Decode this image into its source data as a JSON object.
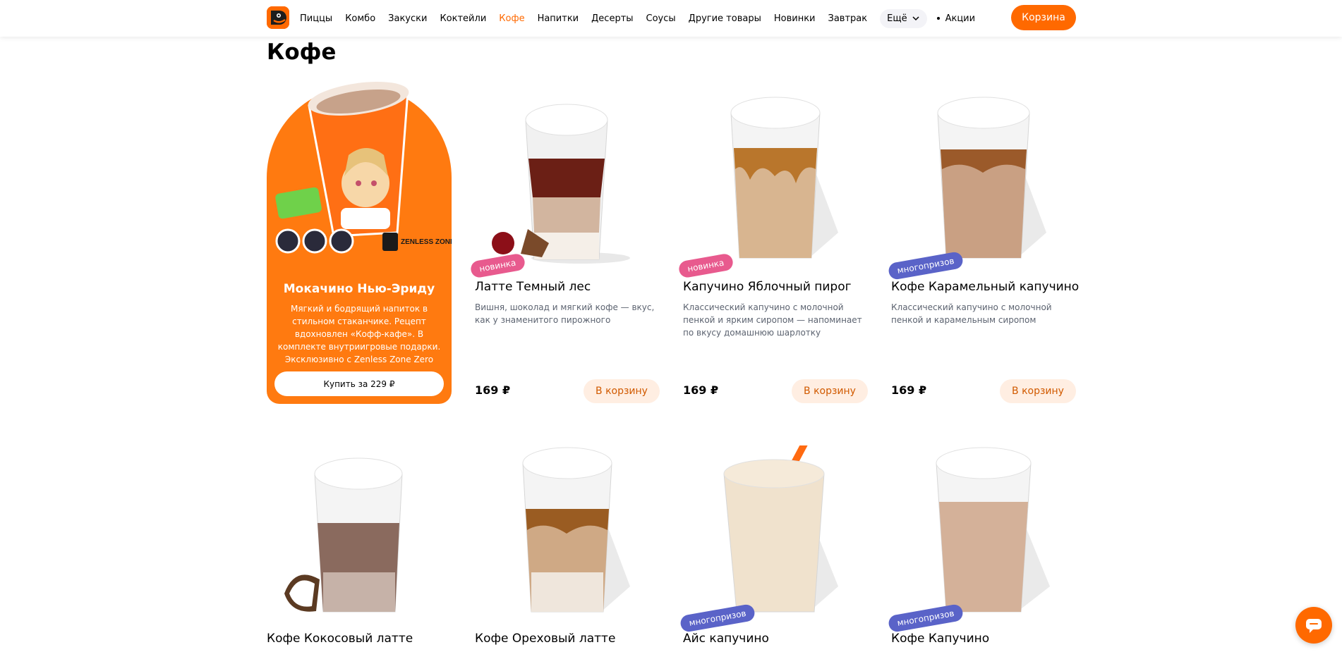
{
  "nav": {
    "items": [
      "Пиццы",
      "Комбо",
      "Закуски",
      "Коктейли",
      "Кофе",
      "Напитки",
      "Десерты",
      "Соусы",
      "Другие товары",
      "Новинки",
      "Завтрак"
    ],
    "more_label": "Ещё",
    "promo_link": "Акции",
    "cart_label": "Корзина",
    "active": "Кофе"
  },
  "page": {
    "title": "Кофе"
  },
  "promo": {
    "title": "Мокачино Нью-Эриду",
    "description": "Мягкий и бодрящий напиток в стильном стаканчике. Рецепт вдохновлен «Кофф-кафе». В комплекте внутриигровые подарки. Эксклюзивно с Zenless Zone Zero",
    "button": "Купить за 229 ₽",
    "art_text": "ZENLESS ZONE ZERO"
  },
  "products": [
    {
      "name": "Латте Темный лес",
      "desc": "Вишня, шоколад и мягкий кофе — вкус, как у знаменитого пирожного",
      "price": "169 ₽",
      "button": "В корзину",
      "badge": "новинка"
    },
    {
      "name": "Капучино Яблочный пирог",
      "desc": "Классический капучино с молочной пенкой и ярким сиропом — напоминает по вкусу домашнюю шарлотку",
      "price": "169 ₽",
      "button": "В корзину",
      "badge": "новинка"
    },
    {
      "name": "Кофе Карамельный капучино",
      "desc": "Классический капучино с молочной пенкой и карамельным сиропом",
      "price": "169 ₽",
      "button": "В корзину",
      "badge": "многопризов"
    },
    {
      "name": "Кофе Кокосовый латте",
      "badge": ""
    },
    {
      "name": "Кофе Ореховый латте",
      "badge": ""
    },
    {
      "name": "Айс капучино",
      "badge": "многопризов"
    },
    {
      "name": "Кофе Капучино",
      "badge": "многопризов"
    }
  ],
  "colors": {
    "accent": "#ff6900",
    "badge_new": "#e85a8e",
    "badge_multi": "#5a63c8"
  },
  "icons": {
    "chevron": "chevron-down-icon",
    "chat": "chat-icon"
  }
}
